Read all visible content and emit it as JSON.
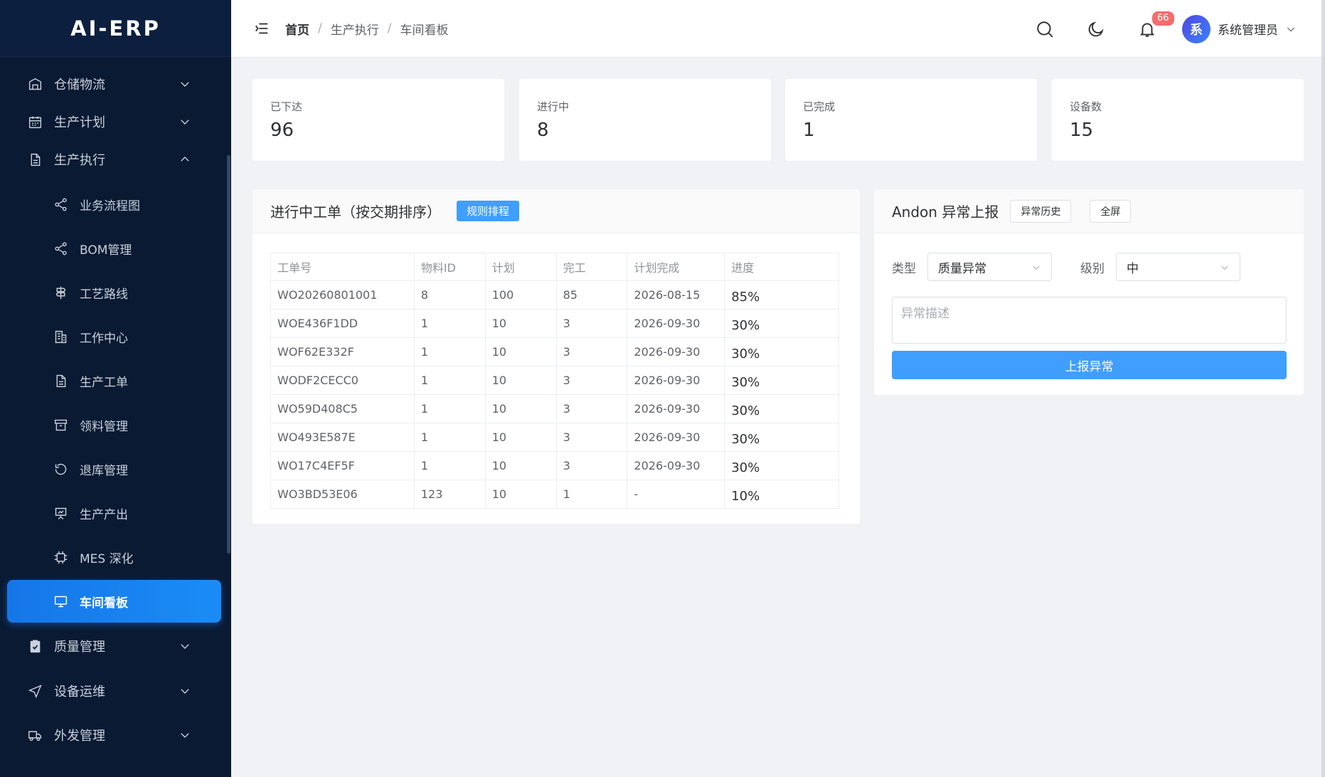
{
  "app": {
    "title": "AI-ERP"
  },
  "sidebar": {
    "top_items": [
      {
        "label": "仓储物流",
        "icon": "warehouse-icon",
        "expanded": false
      },
      {
        "label": "生产计划",
        "icon": "calendar-icon",
        "expanded": false
      },
      {
        "label": "生产执行",
        "icon": "document-icon",
        "expanded": true
      }
    ],
    "sub_items": [
      {
        "label": "业务流程图",
        "icon": "share-icon"
      },
      {
        "label": "BOM管理",
        "icon": "share-icon"
      },
      {
        "label": "工艺路线",
        "icon": "route-icon"
      },
      {
        "label": "工作中心",
        "icon": "building-icon"
      },
      {
        "label": "生产工单",
        "icon": "document-icon"
      },
      {
        "label": "领料管理",
        "icon": "box-icon"
      },
      {
        "label": "退库管理",
        "icon": "refresh-icon"
      },
      {
        "label": "生产产出",
        "icon": "presentation-icon"
      },
      {
        "label": "MES 深化",
        "icon": "cpu-icon"
      },
      {
        "label": "车间看板",
        "icon": "monitor-icon",
        "active": true
      }
    ],
    "bottom_items": [
      {
        "label": "质量管理",
        "icon": "clipboard-check-icon"
      },
      {
        "label": "设备运维",
        "icon": "navigation-icon"
      },
      {
        "label": "外发管理",
        "icon": "truck-icon"
      }
    ]
  },
  "header": {
    "breadcrumb": [
      "首页",
      "生产执行",
      "车间看板"
    ],
    "notification_count": "66",
    "user_avatar": "系",
    "user_name": "系统管理员"
  },
  "stats": [
    {
      "label": "已下达",
      "value": "96"
    },
    {
      "label": "进行中",
      "value": "8"
    },
    {
      "label": "已完成",
      "value": "1"
    },
    {
      "label": "设备数",
      "value": "15"
    }
  ],
  "orders_panel": {
    "title": "进行中工单（按交期排序）",
    "schedule_button": "规则排程",
    "columns": [
      "工单号",
      "物料ID",
      "计划",
      "完工",
      "计划完成",
      "进度"
    ],
    "rows": [
      [
        "WO20260801001",
        "8",
        "100",
        "85",
        "2026-08-15",
        "85%"
      ],
      [
        "WOE436F1DD",
        "1",
        "10",
        "3",
        "2026-09-30",
        "30%"
      ],
      [
        "WOF62E332F",
        "1",
        "10",
        "3",
        "2026-09-30",
        "30%"
      ],
      [
        "WODF2CECC0",
        "1",
        "10",
        "3",
        "2026-09-30",
        "30%"
      ],
      [
        "WO59D408C5",
        "1",
        "10",
        "3",
        "2026-09-30",
        "30%"
      ],
      [
        "WO493E587E",
        "1",
        "10",
        "3",
        "2026-09-30",
        "30%"
      ],
      [
        "WO17C4EF5F",
        "1",
        "10",
        "3",
        "2026-09-30",
        "30%"
      ],
      [
        "WO3BD53E06",
        "123",
        "10",
        "1",
        "-",
        "10%"
      ]
    ]
  },
  "andon_panel": {
    "title": "Andon 异常上报",
    "history_button": "异常历史",
    "fullscreen_button": "全屏",
    "type_label": "类型",
    "type_value": "质量异常",
    "level_label": "级别",
    "level_value": "中",
    "description_placeholder": "异常描述",
    "report_button": "上报异常"
  },
  "colors": {
    "sidebar_bg": "#0a1a33",
    "accent": "#409eff",
    "active_menu": "#1676e8",
    "badge": "#f56c6c"
  }
}
